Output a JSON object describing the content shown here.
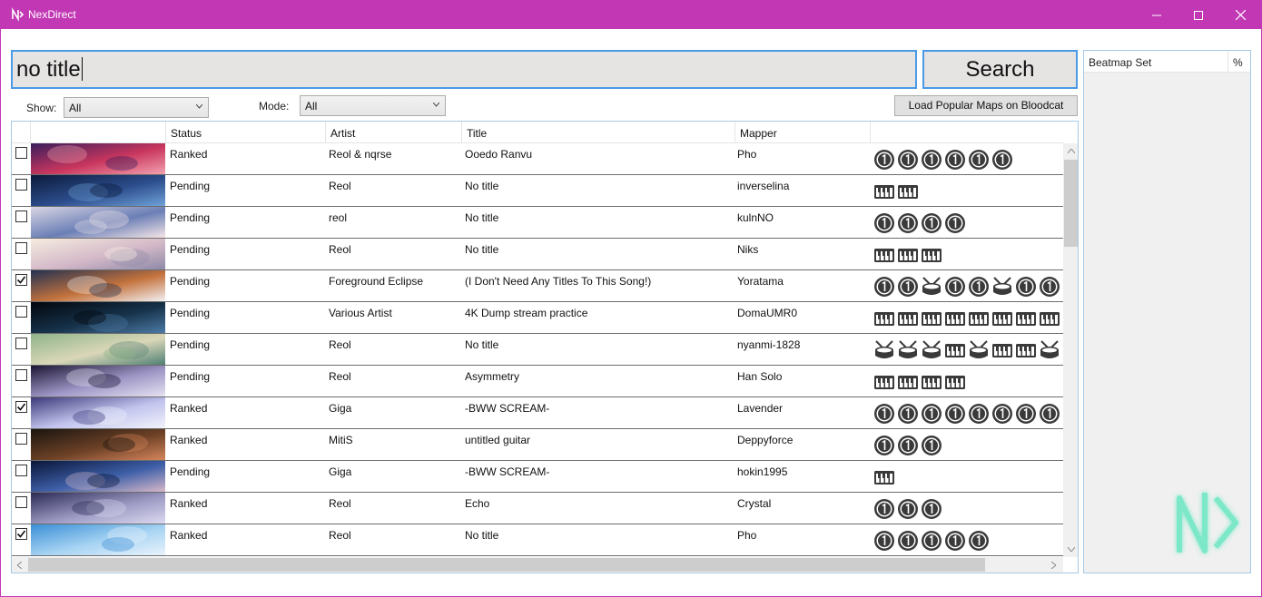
{
  "window": {
    "title": "NexDirect"
  },
  "search": {
    "query": "no title",
    "button_label": "Search"
  },
  "filters": {
    "show_label": "Show:",
    "show_value": "All",
    "mode_label": "Mode:",
    "mode_value": "All",
    "load_popular_label": "Load Popular Maps on Bloodcat"
  },
  "table": {
    "columns": [
      "",
      "",
      "Status",
      "Artist",
      "Title",
      "Mapper",
      ""
    ],
    "rows": [
      {
        "checked": false,
        "status": "Ranked",
        "artist": "Reol & nqrse",
        "title": "Ooedo Ranvu",
        "mapper": "Pho",
        "modes": [
          "osu",
          "osu",
          "osu",
          "osu",
          "osu",
          "osu"
        ]
      },
      {
        "checked": false,
        "status": "Pending",
        "artist": "Reol",
        "title": "No title",
        "mapper": "inverselina",
        "modes": [
          "mania",
          "mania"
        ]
      },
      {
        "checked": false,
        "status": "Pending",
        "artist": "reol",
        "title": "No title",
        "mapper": "kulnNO",
        "modes": [
          "osu",
          "osu",
          "osu",
          "osu"
        ]
      },
      {
        "checked": false,
        "status": "Pending",
        "artist": "Reol",
        "title": "No title",
        "mapper": "Niks",
        "modes": [
          "mania",
          "mania",
          "mania"
        ]
      },
      {
        "checked": true,
        "status": "Pending",
        "artist": "Foreground Eclipse",
        "title": "(I Don't Need Any Titles To This Song!)",
        "mapper": "Yoratama",
        "modes": [
          "osu",
          "osu",
          "taiko",
          "osu",
          "osu",
          "taiko",
          "osu",
          "osu"
        ]
      },
      {
        "checked": false,
        "status": "Pending",
        "artist": "Various Artist",
        "title": "4K Dump stream practice",
        "mapper": "DomaUMR0",
        "modes": [
          "mania",
          "mania",
          "mania",
          "mania",
          "mania",
          "mania",
          "mania",
          "mania"
        ]
      },
      {
        "checked": false,
        "status": "Pending",
        "artist": "Reol",
        "title": "No title",
        "mapper": "nyanmi-1828",
        "modes": [
          "taiko",
          "taiko",
          "taiko",
          "mania",
          "taiko",
          "mania",
          "mania",
          "taiko"
        ]
      },
      {
        "checked": false,
        "status": "Pending",
        "artist": "Reol",
        "title": "Asymmetry",
        "mapper": "Han Solo",
        "modes": [
          "mania",
          "mania",
          "mania",
          "mania"
        ]
      },
      {
        "checked": true,
        "status": "Ranked",
        "artist": "Giga",
        "title": "-BWW SCREAM-",
        "mapper": "Lavender",
        "modes": [
          "osu",
          "osu",
          "osu",
          "osu",
          "osu",
          "osu",
          "osu",
          "osu"
        ]
      },
      {
        "checked": false,
        "status": "Ranked",
        "artist": "MitiS",
        "title": "untitled guitar",
        "mapper": "Deppyforce",
        "modes": [
          "osu",
          "osu",
          "osu"
        ]
      },
      {
        "checked": false,
        "status": "Pending",
        "artist": "Giga",
        "title": "-BWW SCREAM-",
        "mapper": "hokin1995",
        "modes": [
          "mania"
        ]
      },
      {
        "checked": false,
        "status": "Ranked",
        "artist": "Reol",
        "title": "Echo",
        "mapper": "Crystal",
        "modes": [
          "osu",
          "osu",
          "osu"
        ]
      },
      {
        "checked": true,
        "status": "Ranked",
        "artist": "Reol",
        "title": "No title",
        "mapper": "Pho",
        "modes": [
          "osu",
          "osu",
          "osu",
          "osu",
          "osu"
        ]
      }
    ]
  },
  "side_panel": {
    "col_set": "Beatmap Set",
    "col_pct": "%"
  },
  "colors": {
    "titlebar": "#c238b4",
    "accent": "#4a9ae6",
    "logo": "#7de8c8"
  }
}
